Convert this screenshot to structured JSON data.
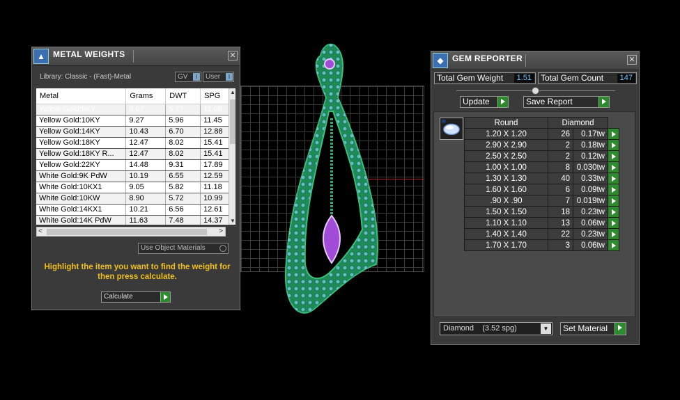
{
  "metal_panel": {
    "title": "METAL WEIGHTS",
    "library_label": "Library: Classic - (Fast)-Metal",
    "gv_toggle": "GV",
    "user_toggle": "User",
    "columns": [
      "Metal",
      "Grams",
      "DWT",
      "SPG"
    ],
    "rows": [
      {
        "metal": "Yellow Gold:9KY",
        "grams": "8.97",
        "dwt": "5.77",
        "spg": "11.08"
      },
      {
        "metal": "Yellow Gold:10KY",
        "grams": "9.27",
        "dwt": "5.96",
        "spg": "11.45"
      },
      {
        "metal": "Yellow Gold:14KY",
        "grams": "10.43",
        "dwt": "6.70",
        "spg": "12.88"
      },
      {
        "metal": "Yellow Gold:18KY",
        "grams": "12.47",
        "dwt": "8.02",
        "spg": "15.41"
      },
      {
        "metal": "Yellow Gold:18KY R...",
        "grams": "12.47",
        "dwt": "8.02",
        "spg": "15.41"
      },
      {
        "metal": "Yellow Gold:22KY",
        "grams": "14.48",
        "dwt": "9.31",
        "spg": "17.89"
      },
      {
        "metal": "White Gold:9K PdW",
        "grams": "10.19",
        "dwt": "6.55",
        "spg": "12.59"
      },
      {
        "metal": "White Gold:10KX1",
        "grams": "9.05",
        "dwt": "5.82",
        "spg": "11.18"
      },
      {
        "metal": "White Gold:10KW",
        "grams": "8.90",
        "dwt": "5.72",
        "spg": "10.99"
      },
      {
        "metal": "White Gold:14KX1",
        "grams": "10.21",
        "dwt": "6.56",
        "spg": "12.61"
      },
      {
        "metal": "White Gold:14K PdW",
        "grams": "11.63",
        "dwt": "7.48",
        "spg": "14.37"
      }
    ],
    "use_object_materials": "Use Object Materials",
    "hint": "Highlight the item you want to find the weight for then press calculate.",
    "calculate_label": "Calculate"
  },
  "gem_panel": {
    "title": "GEM REPORTER",
    "total_weight_label": "Total Gem Weight",
    "total_weight_value": "1.51",
    "total_count_label": "Total Gem Count",
    "total_count_value": "147",
    "update_label": "Update",
    "save_report_label": "Save Report",
    "shape_header": "Round",
    "material_header": "Diamond",
    "gems": [
      {
        "size": "1.20 X 1.20",
        "count": "26",
        "tw": "0.17tw"
      },
      {
        "size": "2.90 X 2.90",
        "count": "2",
        "tw": "0.18tw"
      },
      {
        "size": "2.50 X 2.50",
        "count": "2",
        "tw": "0.12tw"
      },
      {
        "size": "1.00 X 1.00",
        "count": "8",
        "tw": "0.030tw"
      },
      {
        "size": "1.30 X 1.30",
        "count": "40",
        "tw": "0.33tw"
      },
      {
        "size": "1.60 X 1.60",
        "count": "6",
        "tw": "0.09tw"
      },
      {
        "size": ".90 X .90",
        "count": "7",
        "tw": "0.019tw"
      },
      {
        "size": "1.50 X 1.50",
        "count": "18",
        "tw": "0.23tw"
      },
      {
        "size": "1.10 X 1.10",
        "count": "13",
        "tw": "0.06tw"
      },
      {
        "size": "1.40 X 1.40",
        "count": "22",
        "tw": "0.23tw"
      },
      {
        "size": "1.70 X 1.70",
        "count": "3",
        "tw": "0.06tw"
      }
    ],
    "material_select": "Diamond    (3.52 spg)",
    "set_material_label": "Set Material"
  },
  "colors": {
    "highlight_text": "#f0c020",
    "value_blue": "#6fc6ff",
    "go_green": "#2f8a2f",
    "pendant_green": "#1e8a55",
    "gem_purple": "#a04cd8"
  }
}
